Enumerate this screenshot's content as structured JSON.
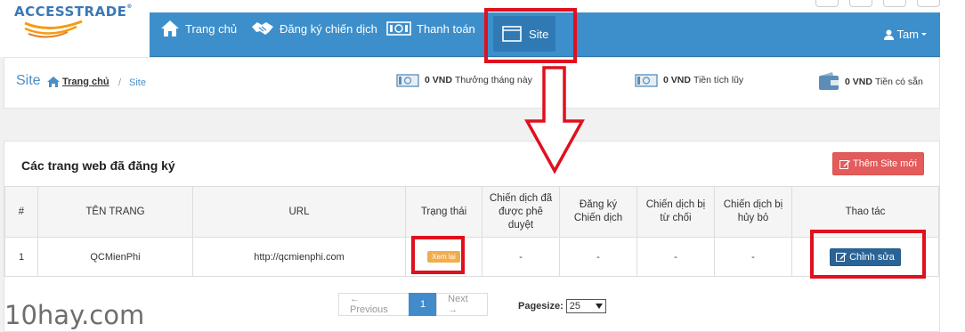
{
  "brand": {
    "name": "ACCESSTRADE",
    "trademark": "®"
  },
  "nav": {
    "items": [
      {
        "label": "Trang chủ",
        "icon": "home-icon"
      },
      {
        "label": "Đăng ký chiến dịch",
        "icon": "handshake-icon"
      },
      {
        "label": "Thanh toán",
        "icon": "money-icon"
      }
    ],
    "active": {
      "label": "Site",
      "icon": "window-icon"
    },
    "user": "Tam"
  },
  "breadcrumb": {
    "title": "Site",
    "home": "Trang chủ",
    "current": "Site"
  },
  "stats": [
    {
      "value": "0 VND",
      "label": "Thưởng tháng này"
    },
    {
      "value": "0 VND",
      "label": "Tiền tích lũy"
    },
    {
      "value": "0 VND",
      "label": "Tiền có sẵn"
    }
  ],
  "panel": {
    "title": "Các trang web đã đăng ký",
    "add_button": "Thêm Site mới"
  },
  "table": {
    "headers": [
      "#",
      "TÊN TRANG",
      "URL",
      "Trạng thái",
      "Chiến dịch đã được phê duyệt",
      "Đăng ký Chiến dịch",
      "Chiến dịch bị từ chối",
      "Chiến dịch bị hủy bỏ",
      "Thao tác"
    ],
    "rows": [
      {
        "index": "1",
        "name": "QCMienPhi",
        "url": "http://qcmienphi.com",
        "status": "Xem lại",
        "approved": "-",
        "registered": "-",
        "rejected": "-",
        "cancelled": "-",
        "action": "Chỉnh sửa"
      }
    ]
  },
  "pagination": {
    "prev": "← Previous",
    "current": "1",
    "next": "Next →",
    "pagesize_label": "Pagesize:",
    "pagesize_value": "25"
  },
  "watermark": "10hay.com",
  "colors": {
    "nav": "#3d8fcb",
    "highlight": "#e0101e",
    "add_button": "#e35b5b",
    "badge": "#f0ad4e",
    "edit_button": "#2a6496"
  }
}
